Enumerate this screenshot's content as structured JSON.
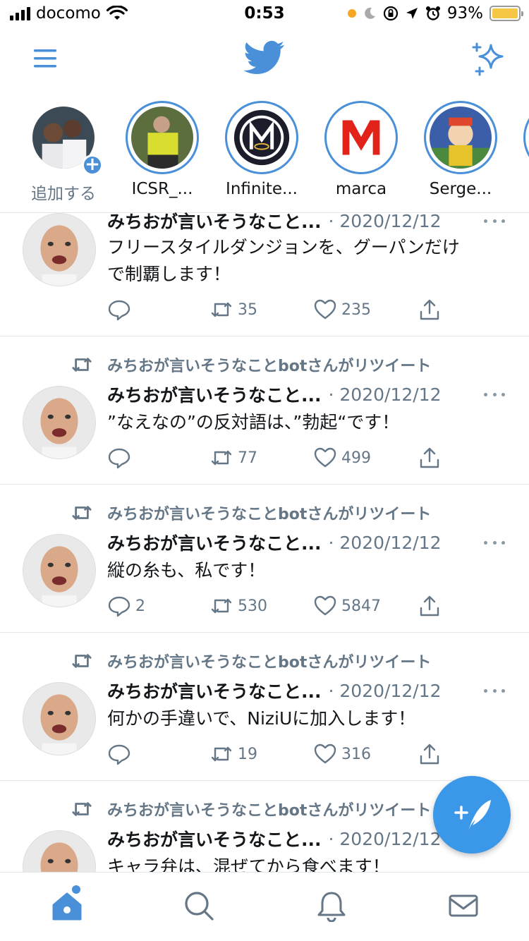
{
  "status_bar": {
    "carrier": "docomo",
    "time": "0:53",
    "battery": "93%"
  },
  "colors": {
    "accent": "#4a90d9",
    "secondary_text": "#657786",
    "fab": "#3b97e8"
  },
  "icons": {
    "header": [
      "menu-icon",
      "twitter-bird-icon",
      "sparkle-icon"
    ],
    "tweet_actions": [
      "reply-icon",
      "retweet-icon",
      "like-icon",
      "share-icon"
    ],
    "tabs": [
      "home-icon",
      "search-icon",
      "notifications-icon",
      "messages-icon"
    ],
    "fab": "compose-feather-icon"
  },
  "fleets": [
    {
      "label": "追加する"
    },
    {
      "label": "ICSR_..."
    },
    {
      "label": "Infinite..."
    },
    {
      "label": "marca"
    },
    {
      "label": "Serge..."
    }
  ],
  "tweets": [
    {
      "retweet_label": "",
      "name": "みちおが言いそうなこと...",
      "date": "· 2020/12/12",
      "text_lines": [
        "フリースタイルダンジョンを、グーパンだけ",
        "で制覇します！"
      ],
      "replies": "",
      "retweets": "35",
      "likes": "235"
    },
    {
      "retweet_label": "みちおが言いそうなことbotさんがリツイート",
      "name": "みちおが言いそうなこと...",
      "date": "· 2020/12/12",
      "text_lines": [
        "”なえなの”の反対語は、”勃起“です！"
      ],
      "replies": "",
      "retweets": "77",
      "likes": "499"
    },
    {
      "retweet_label": "みちおが言いそうなことbotさんがリツイート",
      "name": "みちおが言いそうなこと...",
      "date": "· 2020/12/12",
      "text_lines": [
        "縦の糸も、私です！"
      ],
      "replies": "2",
      "retweets": "530",
      "likes": "5847"
    },
    {
      "retweet_label": "みちおが言いそうなことbotさんがリツイート",
      "name": "みちおが言いそうなこと...",
      "date": "· 2020/12/12",
      "text_lines": [
        "何かの手違いで、NiziUに加入します！"
      ],
      "replies": "",
      "retweets": "19",
      "likes": "316"
    },
    {
      "retweet_label": "みちおが言いそうなことbotさんがリツイート",
      "name": "みちおが言いそうなこと...",
      "date": "· 2020/12/12",
      "text_lines": [
        "キャラ弁は、混ぜてから食べます！"
      ],
      "replies": "",
      "retweets": "",
      "likes": ""
    }
  ]
}
